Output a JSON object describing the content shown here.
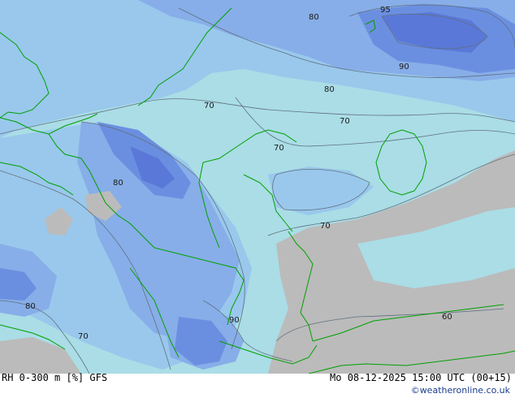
{
  "footer": {
    "left": "RH 0-300 m [%] GFS",
    "right": "Mo 08-12-2025 15:00 UTC (00+15)",
    "credit": "©weatheronline.co.uk"
  },
  "contour_labels": [
    "95",
    "90",
    "80",
    "80",
    "70",
    "70",
    "70",
    "80",
    "70",
    "80",
    "70",
    "90",
    "60"
  ],
  "colors": {
    "band_60_70": "#aadde6",
    "band_70_80": "#99c8ec",
    "band_80_90": "#87aee8",
    "band_90_95": "#6b8fe0",
    "band_95_100": "#5a78d8",
    "band_below_60": "#bbbbbb",
    "border": "#00a000",
    "contour": "#607080"
  }
}
